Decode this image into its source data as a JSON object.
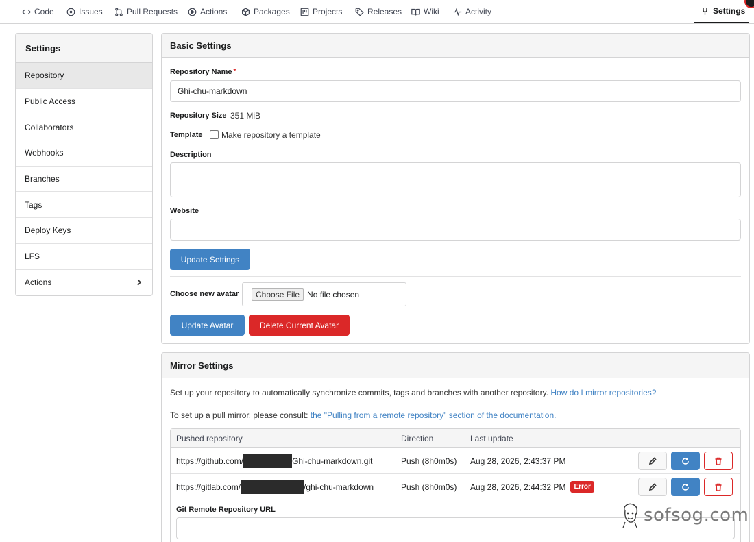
{
  "nav": {
    "items": [
      {
        "label": "Code",
        "icon": "code-icon"
      },
      {
        "label": "Issues",
        "icon": "issue-icon"
      },
      {
        "label": "Pull Requests",
        "icon": "pull-request-icon"
      },
      {
        "label": "Actions",
        "icon": "play-icon"
      },
      {
        "label": "Packages",
        "icon": "package-icon"
      },
      {
        "label": "Projects",
        "icon": "project-icon"
      },
      {
        "label": "Releases",
        "icon": "tag-icon"
      },
      {
        "label": "Wiki",
        "icon": "book-icon"
      },
      {
        "label": "Activity",
        "icon": "pulse-icon"
      }
    ],
    "settings_label": "Settings",
    "settings_icon": "tools-icon"
  },
  "sidebar": {
    "title": "Settings",
    "items": [
      {
        "label": "Repository",
        "active": true
      },
      {
        "label": "Public Access"
      },
      {
        "label": "Collaborators"
      },
      {
        "label": "Webhooks"
      },
      {
        "label": "Branches"
      },
      {
        "label": "Tags"
      },
      {
        "label": "Deploy Keys"
      },
      {
        "label": "LFS"
      },
      {
        "label": "Actions",
        "icon": "chevron-right-icon"
      }
    ]
  },
  "basic": {
    "title": "Basic Settings",
    "repo_name_label": "Repository Name",
    "required_mark": "*",
    "repo_name_value": "Ghi-chu-markdown",
    "repo_size_label": "Repository Size",
    "repo_size_value": "351 MiB",
    "template_label": "Template",
    "template_checkbox_label": "Make repository a template",
    "description_label": "Description",
    "description_value": "",
    "website_label": "Website",
    "website_value": "",
    "update_settings_button": "Update Settings",
    "avatar_label": "Choose new avatar",
    "choose_file_button": "Choose File",
    "no_file_text": "No file chosen",
    "update_avatar_button": "Update Avatar",
    "delete_avatar_button": "Delete Current Avatar"
  },
  "mirror": {
    "title": "Mirror Settings",
    "intro_text": "Set up your repository to automatically synchronize commits, tags and branches with another repository.",
    "intro_link": "How do I mirror repositories?",
    "pull_text": "To set up a pull mirror, please consult:",
    "pull_link": "the \"Pulling from a remote repository\" section of the documentation.",
    "columns": [
      "Pushed repository",
      "Direction",
      "Last update"
    ],
    "rows": [
      {
        "repo_prefix": "https://github.com/",
        "repo_suffix": "Ghi-chu-markdown.git",
        "direction": "Push (8h0m0s)",
        "last_update": "Aug 28, 2026, 2:43:37 PM",
        "badge": ""
      },
      {
        "repo_prefix": "https://gitlab.com/",
        "repo_suffix": "/ghi-chu-markdown",
        "direction": "Push (8h0m0s)",
        "last_update": "Aug 28, 2026, 2:44:32 PM",
        "badge": "Error"
      }
    ],
    "row_icons": [
      "pencil-icon",
      "sync-icon",
      "trash-icon"
    ],
    "git_remote_label": "Git Remote Repository URL",
    "git_remote_value": ""
  },
  "watermark": {
    "text": "sofsog.com"
  },
  "colors": {
    "primary": "#4183c4",
    "danger": "#db2828",
    "border": "#d4d4d5",
    "header_bg": "#f5f5f5"
  }
}
